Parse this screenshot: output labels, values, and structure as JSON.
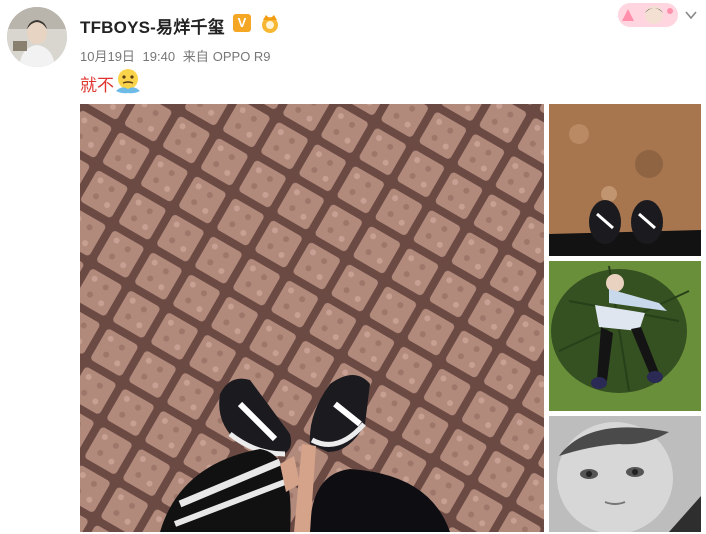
{
  "post": {
    "username": "TFBOYS-易烊千玺",
    "date": "10月19日",
    "time": "19:40",
    "source_prefix": "来自",
    "source_device": "OPPO R9",
    "text": "就不"
  },
  "icons": {
    "verified": "V",
    "level_badge": "crown-badge-icon",
    "emoji": "thinking-face-icon",
    "menu": "chevron-down-icon"
  },
  "colors": {
    "post_text": "#e0342f",
    "verified_badge": "#f5a623",
    "meta_text": "#777777"
  },
  "photos": [
    {
      "name": "sneakers on brick pavement"
    },
    {
      "name": "sneakers on dirt ground"
    },
    {
      "name": "person lying on grass with umbrella"
    },
    {
      "name": "grayscale face close-up"
    }
  ]
}
